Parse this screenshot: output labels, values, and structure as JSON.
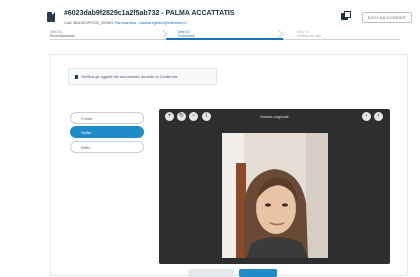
{
  "header": {
    "title": "#6023dab9f2829c1a2f5ab732 - PALMA ACCATTATIS",
    "subtitle_prefix": "Cod: BACKOFFICE_DEMO",
    "subtitle_link": "Panoramica · bancaregistra@infinwork.it",
    "exit_label": "ESCI DA DOSSIER"
  },
  "steps": [
    {
      "num": "Step 01",
      "label": "Riconoscimento"
    },
    {
      "num": "Step 02",
      "label": "Documenti"
    },
    {
      "num": "Step 03",
      "label": "Verifica dei dati"
    }
  ],
  "notice": {
    "text": "Verifica gli oggetti del documento durante la Conferma"
  },
  "document_options": [
    {
      "label": "Fronte"
    },
    {
      "label": "Selfie"
    },
    {
      "label": "Retro"
    }
  ],
  "viewer": {
    "title": "Mostra originale",
    "tools": [
      "zoom-in-icon",
      "rotate-icon",
      "zoom-out-icon",
      "info-icon"
    ],
    "nav": [
      "previous-icon",
      "next-icon"
    ]
  },
  "colors": {
    "accent": "#1f8cc9",
    "viewer_bg": "#2e2e2e"
  }
}
